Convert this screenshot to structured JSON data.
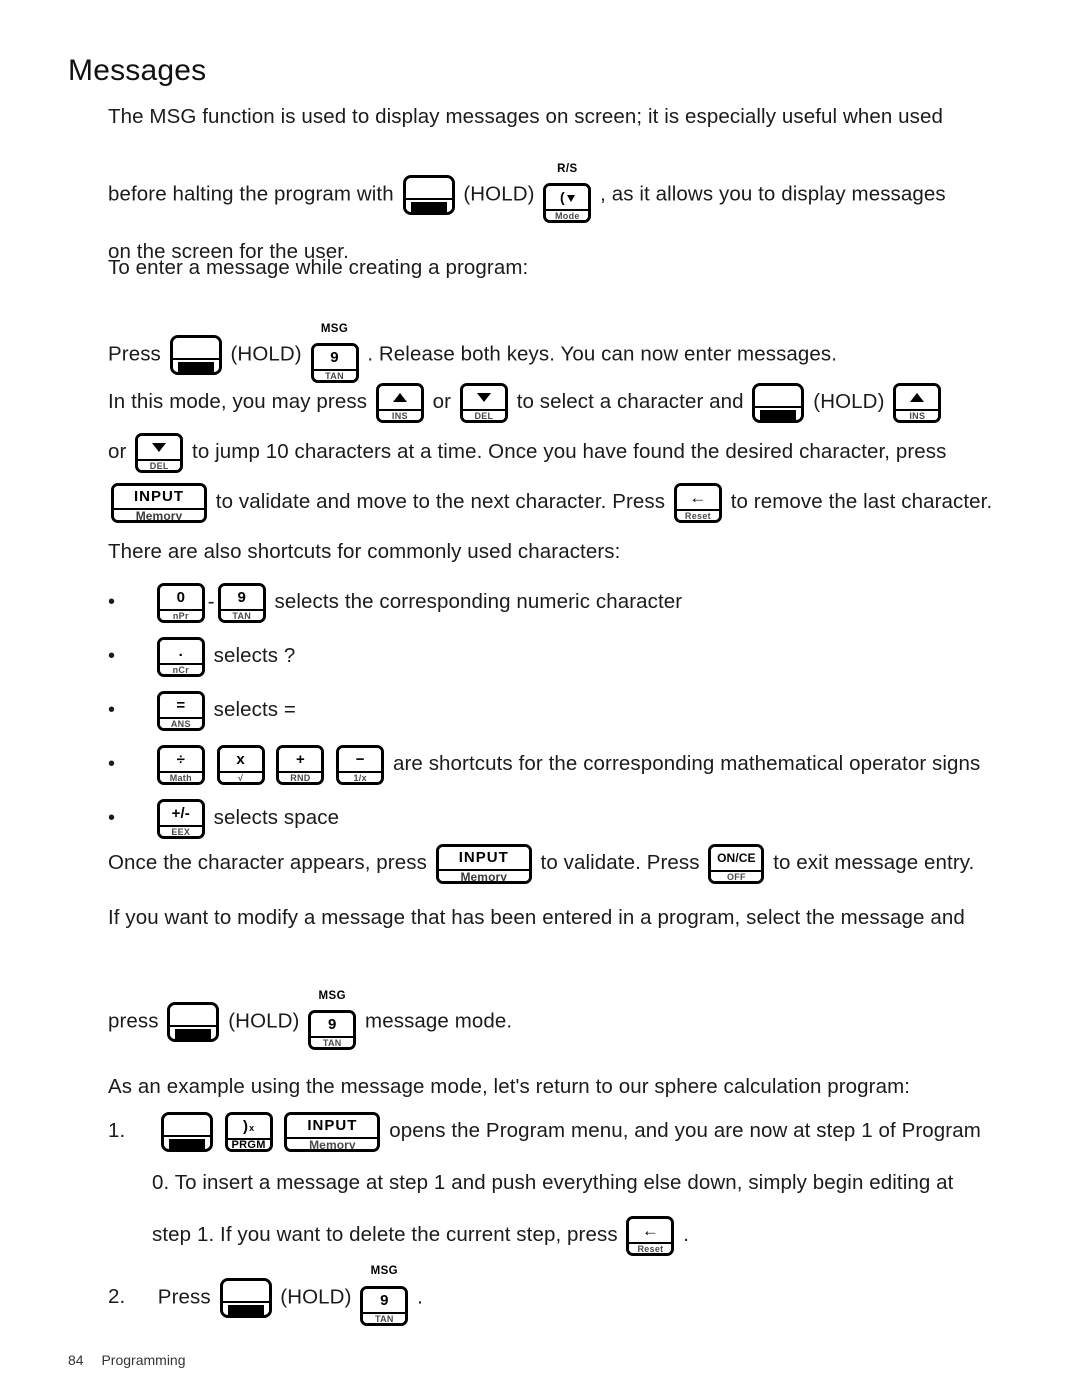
{
  "page": {
    "heading": "Messages",
    "footer_page_number": "84",
    "footer_section": "Programming"
  },
  "paragraphs": {
    "intro_line1": "The MSG function is used to display messages on screen; it is especially useful when used",
    "intro_line2_a": "before halting the program with",
    "intro_line2_hold": "(HOLD)",
    "intro_line2_b": ", as it allows you to display messages",
    "intro_line3": "on the screen for the user.",
    "to_enter": "To enter a message while creating a program:",
    "press_label": "Press",
    "press_hold": "(HOLD)",
    "press_after": ". Release both keys. You can now enter messages.",
    "mode_line_a": "In this mode, you may press",
    "mode_line_or": "or",
    "mode_line_b": "to select a character and",
    "mode_line_hold": "(HOLD)",
    "jump_line_or": "or",
    "jump_line_b": "to jump 10 characters at a time. Once you have found the desired character, press",
    "validate_a": "to validate and move to the next character. Press",
    "validate_b": "to remove the last character.",
    "shortcuts_intro": "There are also shortcuts for commonly used characters:",
    "once_char_a": "Once the character appears, press",
    "once_char_b": "to validate. Press",
    "once_char_c": "to exit message entry.",
    "modify_line": "If you want to modify a message that has been entered in a program, select the message and",
    "press2_label": "press",
    "press2_hold": "(HOLD)",
    "press2_after": "message mode.",
    "example_line": "As an example using the message mode, let's return to our sphere calculation program:"
  },
  "bullets": [
    {
      "id": "numeric",
      "text": "selects the corresponding numeric character",
      "separator": "-"
    },
    {
      "id": "question",
      "text": "selects ?"
    },
    {
      "id": "equals",
      "text": "selects ="
    },
    {
      "id": "operators",
      "text": "are shortcuts for the corresponding mathematical operator signs"
    },
    {
      "id": "space",
      "text": "selects space"
    }
  ],
  "numbered": [
    {
      "marker": "1.",
      "line1_after": "opens the Program menu, and you are now at step 1 of Program",
      "line2": "0. To insert a message at step 1 and push everything else down, simply begin editing at",
      "line3_a": "step 1. If you want to delete the current step, press",
      "line3_b": "."
    },
    {
      "marker": "2.",
      "label": "Press",
      "hold": "(HOLD)",
      "after": "."
    }
  ],
  "keys": {
    "shift": {
      "name": "shift-key",
      "top": "",
      "band": ""
    },
    "rs_mode": {
      "suplabel": "R/S",
      "top": "( ↓",
      "band": "Mode"
    },
    "msg_9_tan": {
      "suplabel": "MSG",
      "top": "9",
      "band": "TAN"
    },
    "up_ins": {
      "top": "▲",
      "band": "INS"
    },
    "down_del": {
      "top": "▼",
      "band": "DEL"
    },
    "input_memory": {
      "top": "INPUT",
      "band": "Memory"
    },
    "backspace_reset": {
      "top": "←",
      "band": "Reset"
    },
    "zero_npr": {
      "top": "0",
      "band": "nPr"
    },
    "nine_tan": {
      "top": "9",
      "band": "TAN"
    },
    "dot_ncr": {
      "top": ".",
      "band": "nCr"
    },
    "equals_ans": {
      "top": "=",
      "band": "ANS"
    },
    "divide_math": {
      "top": "÷",
      "band": "Math"
    },
    "times_sqrt": {
      "top": "x",
      "band": "√"
    },
    "plus_rnd": {
      "top": "+",
      "band": "RND"
    },
    "minus_inv": {
      "top": "−",
      "band": "1/x"
    },
    "plusminus_eex": {
      "top": "+/-",
      "band": "EEX"
    },
    "on_ce_off": {
      "top": "ON/CE",
      "band": "OFF"
    },
    "paren_prgm": {
      "top": ")x",
      "band": "PRGM"
    }
  },
  "colors": {
    "text": "#1b1b1b",
    "key_outline": "#000000",
    "key_band_text": "#3b3b3b",
    "background": "#ffffff"
  }
}
